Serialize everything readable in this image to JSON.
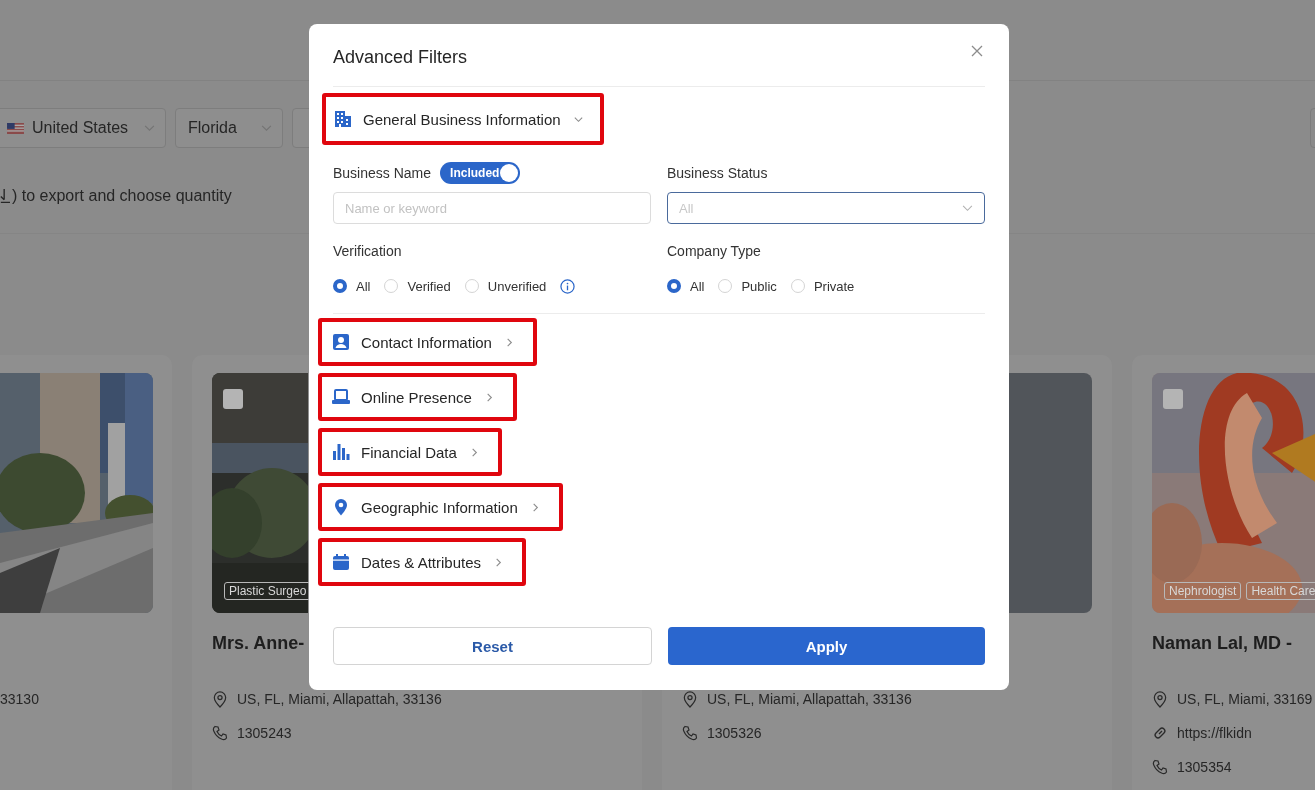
{
  "background": {
    "filters": [
      {
        "value": "United States",
        "flag": true
      },
      {
        "value": "Florida",
        "flag": false
      }
    ],
    "export_hint": ") to export and choose quantity",
    "cards": [
      {
        "kind": "partial",
        "address": "33130"
      },
      {
        "kind": "full",
        "checked": false,
        "tags": [
          "Plastic Surgeo"
        ],
        "title": "Mrs. Anne-",
        "address": "US, FL, Miami, Allapattah, 33136",
        "phone": "1305243"
      },
      {
        "kind": "full",
        "address": "US, FL, Miami, Allapattah, 33136",
        "phone": "1305326"
      },
      {
        "kind": "full",
        "checked": false,
        "tags": [
          "Nephrologist",
          "Health Care"
        ],
        "title": "Naman Lal, MD -",
        "address": "US, FL, Miami, 33169",
        "website": "https://flkidn",
        "phone": "1305354"
      }
    ]
  },
  "modal": {
    "title": "Advanced Filters",
    "general": {
      "business_name": {
        "label": "Business Name",
        "toggle": {
          "label": "Included",
          "on": true
        },
        "placeholder": "Name or keyword"
      },
      "business_status": {
        "label": "Business Status",
        "placeholder": "All",
        "focused": true
      },
      "verification": {
        "label": "Verification",
        "options": [
          {
            "label": "All",
            "selected": true
          },
          {
            "label": "Verified",
            "selected": false
          },
          {
            "label": "Unverified",
            "selected": false
          }
        ]
      },
      "company_type": {
        "label": "Company Type",
        "options": [
          {
            "label": "All",
            "selected": true
          },
          {
            "label": "Public",
            "selected": false
          },
          {
            "label": "Private",
            "selected": false
          }
        ]
      }
    },
    "sections": [
      {
        "label": "General Business Information",
        "expanded": true,
        "highlighted": true
      },
      {
        "label": "Contact Information",
        "expanded": false,
        "highlighted": true
      },
      {
        "label": "Online Presence",
        "expanded": false,
        "highlighted": true
      },
      {
        "label": "Financial Data",
        "expanded": false,
        "highlighted": true
      },
      {
        "label": "Geographic Information",
        "expanded": false,
        "highlighted": true
      },
      {
        "label": "Dates & Attributes",
        "expanded": false,
        "highlighted": true
      }
    ],
    "buttons": {
      "reset": "Reset",
      "apply": "Apply"
    }
  }
}
